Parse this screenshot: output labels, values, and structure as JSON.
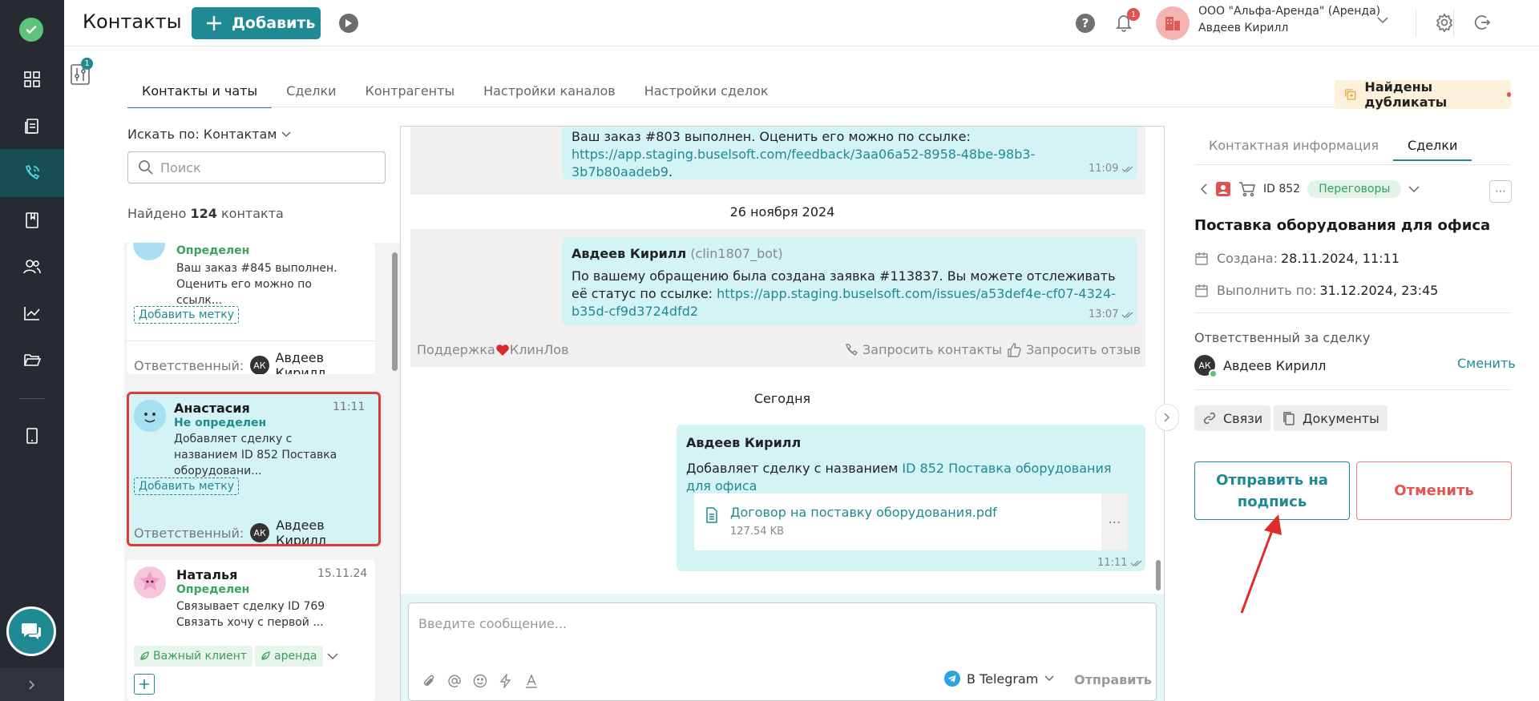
{
  "header": {
    "title": "Контакты",
    "add_label": "Добавить",
    "notif_count": "1",
    "company": "ООО \"Альфа-Аренда\" (Аренда)",
    "user": "Авдеев Кирилл",
    "filter_count": "1"
  },
  "tabs": [
    {
      "label": "Контакты и чаты"
    },
    {
      "label": "Сделки"
    },
    {
      "label": "Контрагенты"
    },
    {
      "label": "Настройки каналов"
    },
    {
      "label": "Настройки сделок"
    }
  ],
  "duplicates_label": "Найдены дубликаты",
  "list": {
    "search_by": "Искать по: Контактам",
    "search_placeholder": "Поиск",
    "found_prefix": "Найдено",
    "found_count": "124",
    "found_suffix": "контакта"
  },
  "cards": [
    {
      "status": "Определен",
      "message": "Ваш заказ #845 выполнен. Оценить его можно по ссылк...",
      "add_tag": "Добавить метку",
      "resp_label": "Ответственный:",
      "resp_initials": "АК",
      "resp_name": "Авдеев Кирилл"
    },
    {
      "name": "Анастасия",
      "time": "11:11",
      "status": "Не определен",
      "message": "Добавляет сделку с названием ID 852 Поставка оборудовани...",
      "add_tag": "Добавить метку",
      "resp_label": "Ответственный:",
      "resp_initials": "АК",
      "resp_name": "Авдеев Кирилл"
    },
    {
      "name": "Наталья",
      "time": "15.11.24",
      "status": "Определен",
      "message": "Связывает сделку ID 769 Связать хочу с первой ...",
      "tags": [
        "Важный клиент",
        "аренда"
      ]
    }
  ],
  "chat": {
    "msg1_text": "Ваш заказ #803 выполнен. Оценить его можно по ссылке:",
    "msg1_link": "https://app.staging.buselsoft.com/feedback/3aa06a52-8958-48be-98b3-3b7b80aadeb9",
    "msg1_time": "11:09",
    "date1": "26 ноября 2024",
    "msg2_sender": "Авдеев Кирилл",
    "msg2_bot": "(clin1807_bot)",
    "msg2_text": "По вашему обращению была создана заявка #113837. Вы можете отслеживать её статус по ссылке:",
    "msg2_link": "https://app.staging.buselsoft.com/issues/a53def4e-cf07-4324-b35d-cf9d3724dfd2",
    "msg2_time": "13:07",
    "support_a": "Поддержка",
    "support_b": "КлинЛов",
    "request_contacts": "Запросить контакты",
    "request_review": "Запросить отзыв",
    "date2": "Сегодня",
    "msg3_sender": "Авдеев Кирилл",
    "msg3_text": "Добавляет сделку с названием",
    "msg3_link": "ID 852 Поставка оборудования для офиса",
    "file_name": "Договор на поставку оборудования.pdf",
    "file_size": "127.54 KB",
    "msg3_time": "11:11",
    "input_placeholder": "Введите сообщение...",
    "channel": "В Telegram",
    "send": "Отправить"
  },
  "right": {
    "tab_info": "Контактная информация",
    "tab_deals": "Сделки",
    "deal_id": "ID 852",
    "stage": "Переговоры",
    "deal_title": "Поставка оборудования для офиса",
    "created_label": "Создана:",
    "created_value": "28.11.2024, 11:11",
    "due_label": "Выполнить по:",
    "due_value": "31.12.2024, 23:45",
    "resp_title": "Ответственный за сделку",
    "resp_initials": "АК",
    "resp_name": "Авдеев Кирилл",
    "change": "Сменить",
    "links": "Связи",
    "docs": "Документы",
    "sign_line1": "Отправить на",
    "sign_line2": "подпись",
    "cancel": "Отменить"
  },
  "colors": {
    "accent": "#1f8a94",
    "danger": "#e35552",
    "sidebar": "#262a31"
  }
}
